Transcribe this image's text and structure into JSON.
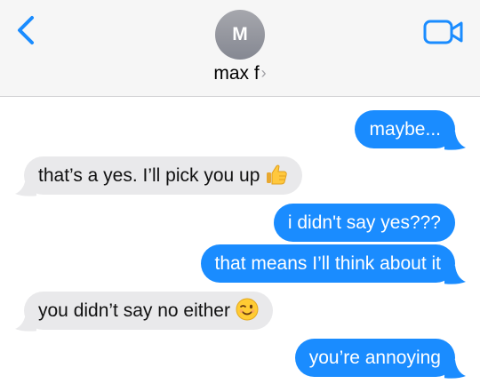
{
  "header": {
    "avatar_initial": "M",
    "contact_name": "max f",
    "contact_chevron": "›",
    "back_icon": "chevron-left-icon",
    "video_icon": "video-camera-icon",
    "accent_color": "#1a8cff"
  },
  "messages": [
    {
      "direction": "sent",
      "text": "maybe..."
    },
    {
      "direction": "received",
      "text": "that’s a yes. I’ll pick you up",
      "emoji": "thumbs-up-icon"
    },
    {
      "direction": "sent",
      "text": "i didn't say yes???"
    },
    {
      "direction": "sent",
      "text": "that means I’ll think about it"
    },
    {
      "direction": "received",
      "text": "you didn’t say no either",
      "emoji": "winking-face-icon"
    },
    {
      "direction": "sent",
      "text": "you’re annoying"
    }
  ]
}
